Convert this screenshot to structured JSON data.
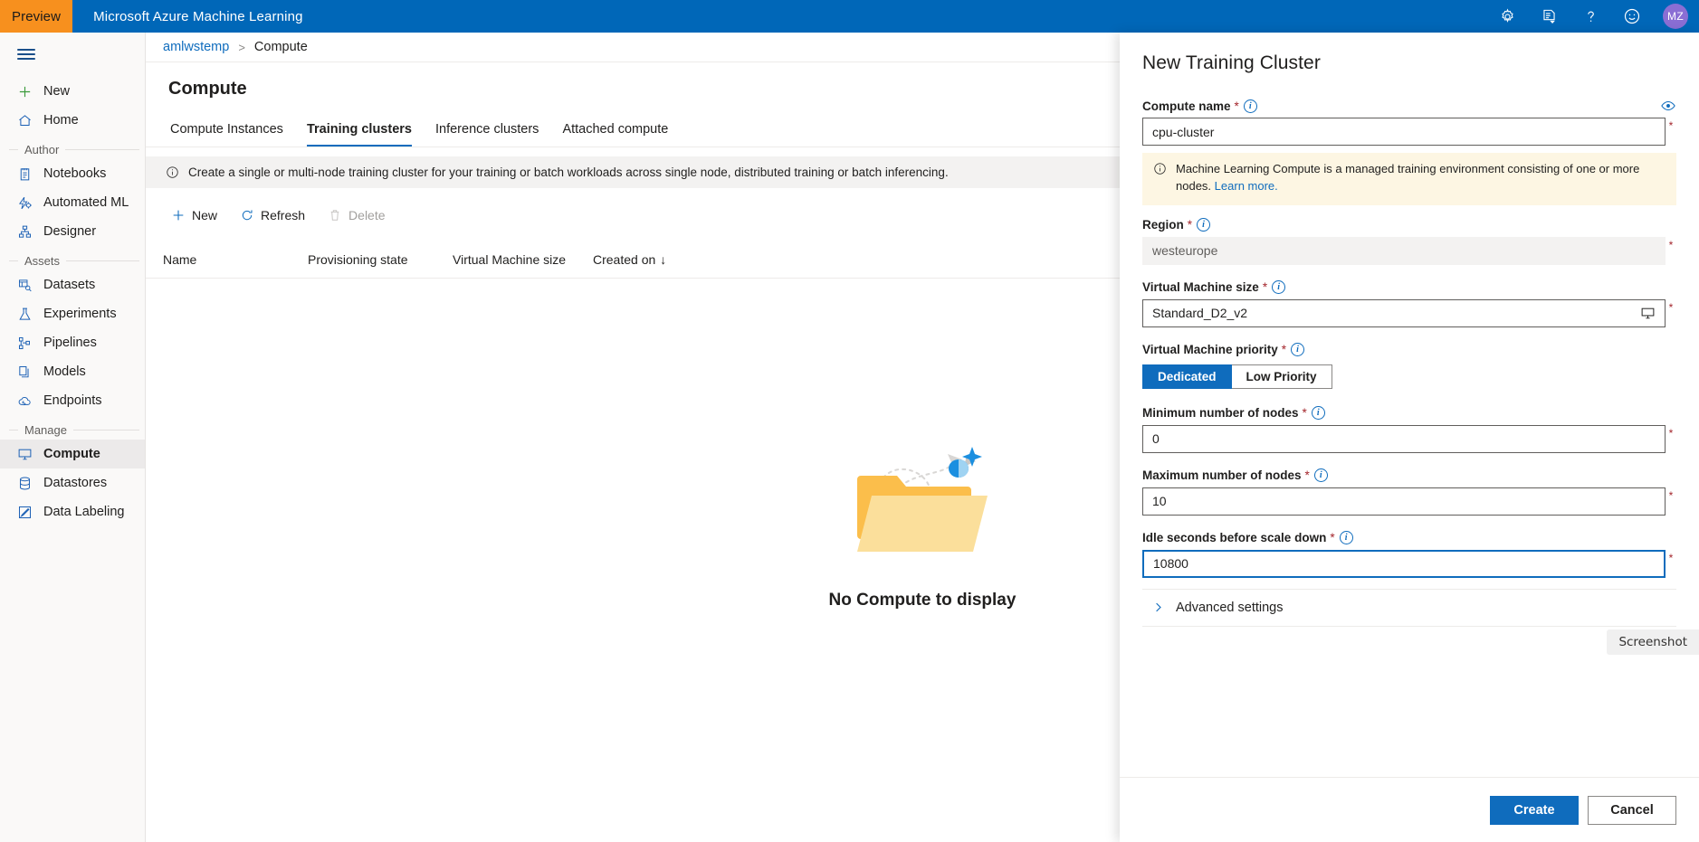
{
  "topbar": {
    "preview_badge": "Preview",
    "title": "Microsoft Azure Machine Learning",
    "icons": [
      "gear-icon",
      "feedback-note-icon",
      "help-icon",
      "smiley-icon"
    ],
    "avatar_initials": "MZ",
    "brand_color": "#0067b8",
    "preview_color": "#f7901e",
    "avatar_color": "#8a6ed4"
  },
  "sidebar": {
    "menu_icon": "hamburger-icon",
    "top_items": [
      {
        "label": "New",
        "icon": "plus-icon"
      },
      {
        "label": "Home",
        "icon": "home-icon"
      }
    ],
    "sections": [
      {
        "title": "Author",
        "items": [
          {
            "label": "Notebooks",
            "icon": "notebook-icon"
          },
          {
            "label": "Automated ML",
            "icon": "automated-ml-icon"
          },
          {
            "label": "Designer",
            "icon": "designer-icon"
          }
        ]
      },
      {
        "title": "Assets",
        "items": [
          {
            "label": "Datasets",
            "icon": "datasets-icon"
          },
          {
            "label": "Experiments",
            "icon": "experiments-flask-icon"
          },
          {
            "label": "Pipelines",
            "icon": "pipelines-icon"
          },
          {
            "label": "Models",
            "icon": "models-icon"
          },
          {
            "label": "Endpoints",
            "icon": "endpoints-cloud-icon"
          }
        ]
      },
      {
        "title": "Manage",
        "items": [
          {
            "label": "Compute",
            "icon": "compute-monitor-icon",
            "active": true
          },
          {
            "label": "Datastores",
            "icon": "datastores-icon"
          },
          {
            "label": "Data Labeling",
            "icon": "data-labeling-icon"
          }
        ]
      }
    ]
  },
  "breadcrumb": {
    "workspace": "amlwstemp",
    "separator": ">",
    "current": "Compute"
  },
  "page": {
    "title": "Compute",
    "tabs": [
      {
        "label": "Compute Instances",
        "active": false
      },
      {
        "label": "Training clusters",
        "active": true
      },
      {
        "label": "Inference clusters",
        "active": false
      },
      {
        "label": "Attached compute",
        "active": false
      }
    ],
    "info_bar": "Create a single or multi-node training cluster for your training or batch workloads across single node, distributed training or batch inferencing.",
    "toolbar": [
      {
        "label": "New",
        "icon": "plus-icon",
        "disabled": false
      },
      {
        "label": "Refresh",
        "icon": "refresh-icon",
        "disabled": false
      },
      {
        "label": "Delete",
        "icon": "trash-icon",
        "disabled": true
      }
    ],
    "table": {
      "columns": [
        "Name",
        "Provisioning state",
        "Virtual Machine size",
        "Created on"
      ],
      "sort_column": "Created on",
      "sort_arrow": "↓",
      "rows": []
    },
    "empty_state": {
      "caption": "No Compute to display",
      "illustration": "empty-folder-bee-illustration"
    }
  },
  "panel": {
    "title": "New Training Cluster",
    "fields": {
      "compute_name": {
        "label": "Compute name",
        "required_mark": "*",
        "info_icon": "info-icon",
        "eye_icon": "visibility-eye-icon",
        "value": "cpu-cluster"
      },
      "notice": {
        "icon": "info-icon",
        "text": "Machine Learning Compute is a managed training environment consisting of one or more nodes.",
        "link_text": "Learn more."
      },
      "region": {
        "label": "Region",
        "required_mark": "*",
        "value": "westeurope",
        "disabled": true
      },
      "vm_size": {
        "label": "Virtual Machine size",
        "required_mark": "*",
        "value": "Standard_D2_v2",
        "trailing_icon": "compute-monitor-icon"
      },
      "vm_priority": {
        "label": "Virtual Machine priority",
        "required_mark": "*",
        "options": [
          {
            "label": "Dedicated",
            "selected": true
          },
          {
            "label": "Low Priority",
            "selected": false
          }
        ]
      },
      "min_nodes": {
        "label": "Minimum number of nodes",
        "required_mark": "*",
        "value": "0"
      },
      "max_nodes": {
        "label": "Maximum number of nodes",
        "required_mark": "*",
        "value": "10"
      },
      "idle_seconds": {
        "label": "Idle seconds before scale down",
        "required_mark": "*",
        "value": "10800",
        "focused": true
      }
    },
    "advanced_settings": {
      "label": "Advanced settings",
      "chevron": "chevron-right-icon",
      "expanded": false
    },
    "footer": {
      "create_label": "Create",
      "cancel_label": "Cancel"
    },
    "accent_color": "#0f6cbd",
    "required_color": "#a4262c"
  },
  "overlay": {
    "screenshot_chip": "Screenshot"
  }
}
